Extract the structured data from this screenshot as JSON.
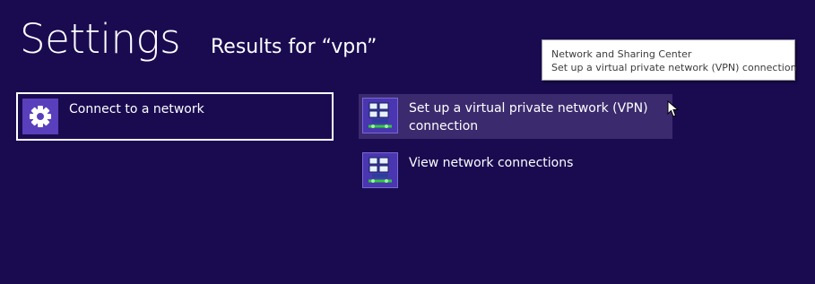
{
  "header": {
    "title": "Settings",
    "results_label": "Results for “vpn”"
  },
  "results": {
    "left": [
      {
        "label": "Connect to a network",
        "icon": "gear-icon"
      }
    ],
    "right": [
      {
        "label": "Set up a virtual private network (VPN) connection",
        "icon": "network-icon"
      },
      {
        "label": "View network connections",
        "icon": "network-icon"
      }
    ]
  },
  "tooltip": {
    "line1": "Network and Sharing Center",
    "line2": "Set up a virtual private network (VPN) connection"
  },
  "colors": {
    "background": "#1a0b51",
    "hover_tile": "#3b2a6e",
    "icon_tile": "#5a3fbd"
  }
}
